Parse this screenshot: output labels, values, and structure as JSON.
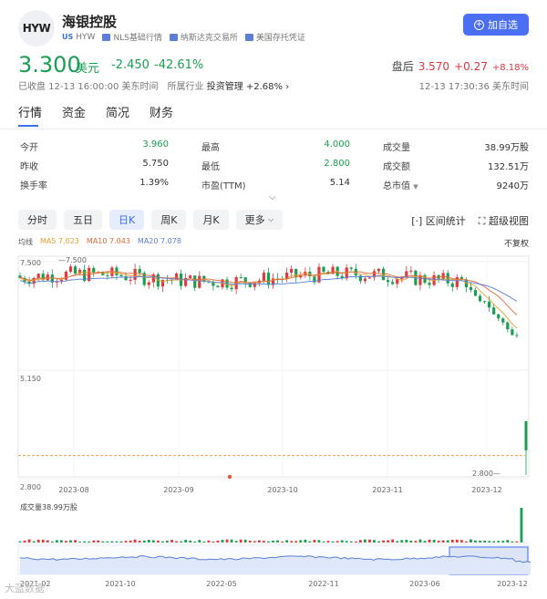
{
  "header": {
    "logo": "HYW",
    "name": "海银控股",
    "tags": {
      "us": "US",
      "code": "HYW",
      "nls": "NLS基础行情",
      "exchange": "纳斯达克交易所",
      "adr": "美国存托凭证"
    },
    "add_button": "加自选"
  },
  "quote": {
    "price": "3.300",
    "unit": "美元",
    "change": "-2.450",
    "change_pct": "-42.61%",
    "after_label": "盘后",
    "after_price": "3.570",
    "after_change": "+0.27",
    "after_pct": "+8.18%",
    "status": "已收盘 12-13 16:00:00 美东时间",
    "industry_label": "所属行业",
    "industry": "投资管理",
    "industry_pct": "+2.68%",
    "after_time": "12-13 17:30:36 美东时间"
  },
  "tabs": [
    "行情",
    "资金",
    "简况",
    "财务"
  ],
  "stats": [
    [
      {
        "k": "今开",
        "v": "3.960",
        "c": "g"
      },
      {
        "k": "最高",
        "v": "4.000",
        "c": "g"
      },
      {
        "k": "成交量",
        "v": "38.99万股",
        "c": ""
      }
    ],
    [
      {
        "k": "昨收",
        "v": "5.750",
        "c": ""
      },
      {
        "k": "最低",
        "v": "2.800",
        "c": "g"
      },
      {
        "k": "成交额",
        "v": "132.51万",
        "c": ""
      }
    ],
    [
      {
        "k": "换手率",
        "v": "1.39%",
        "c": ""
      },
      {
        "k": "市盈(TTM)",
        "v": "5.14",
        "c": ""
      },
      {
        "k": "总市值",
        "v": "9240万",
        "c": ""
      }
    ]
  ],
  "periods": [
    "分时",
    "五日",
    "日K",
    "周K",
    "月K",
    "更多"
  ],
  "selected_period": "日K",
  "tools": {
    "range": "区间统计",
    "super": "超级视图"
  },
  "legend": {
    "label": "均线",
    "ma5": "MA5 7.023",
    "ma10": "MA10 7.043",
    "ma20": "MA20 7.078"
  },
  "adjust": "不复权",
  "chart_data": {
    "type": "candlestick",
    "y_ticks": [
      "7.500",
      "5.150",
      "2.800"
    ],
    "annotations": {
      "high": "7.500",
      "low": "2.800"
    },
    "x_ticks": [
      "2023-08",
      "2023-09",
      "2023-10",
      "2023-11",
      "2023-12"
    ],
    "last_close": 3.3,
    "volume_label": "成交量38.99万股",
    "overview_x_ticks": [
      "2021-02",
      "2021-10",
      "2022-05",
      "2022-11",
      "2023-06",
      "2023-12"
    ]
  },
  "colors": {
    "up": "#e0393e",
    "down": "#1a9e52",
    "ma5": "#e3a033",
    "ma10": "#e06a3a",
    "ma20": "#5b7fd6",
    "accent": "#3a6ff2"
  },
  "watermark": "大蓝数据"
}
